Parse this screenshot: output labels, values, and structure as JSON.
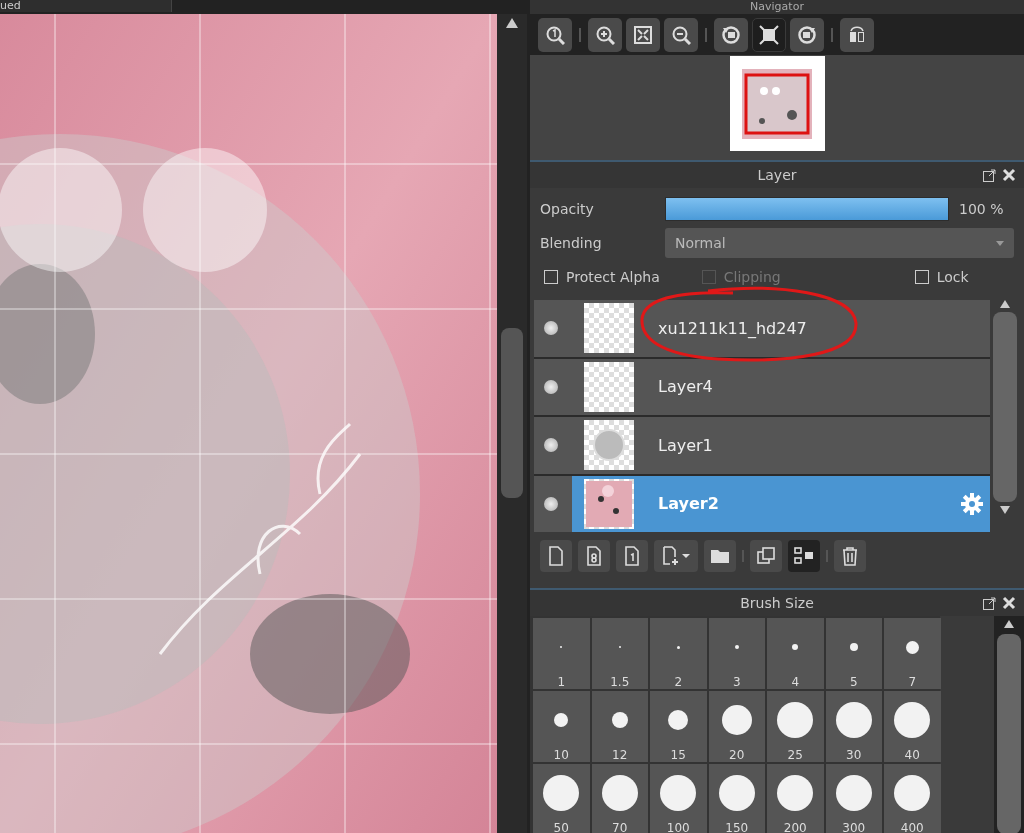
{
  "canvas_tab": {
    "label": "ued"
  },
  "navigator": {
    "title": "Navigator",
    "tools": [
      {
        "selected": false
      },
      {
        "selected": false
      },
      {
        "selected": false
      },
      {
        "selected": false
      },
      {
        "selected": false
      },
      {
        "selected": true
      },
      {
        "selected": false
      },
      {
        "selected": false
      }
    ]
  },
  "layer_panel": {
    "title": "Layer",
    "opacity_label": "Opacity",
    "opacity": {
      "level": 1,
      "reading": "100 %"
    },
    "blending_label": "Blending",
    "blending": "Normal",
    "options": [
      {
        "label": "Protect Alpha",
        "checked": false,
        "disabled": false
      },
      {
        "label": "Clipping",
        "checked": false,
        "disabled": true
      },
      {
        "label": "Lock",
        "checked": false,
        "disabled": false
      }
    ],
    "layers": [
      {
        "name": "xu1211k11_hd247",
        "kind": "empty",
        "selected": false,
        "annotated": true
      },
      {
        "name": "Layer4",
        "kind": "empty",
        "selected": false,
        "annotated": false
      },
      {
        "name": "Layer1",
        "kind": "circle",
        "selected": false,
        "annotated": false
      },
      {
        "name": "Layer2",
        "kind": "art",
        "selected": true,
        "annotated": false
      }
    ]
  },
  "brush_panel": {
    "title": "Brush Size",
    "sizes": [
      "1",
      "1.5",
      "2",
      "3",
      "4",
      "5",
      "7",
      "10",
      "12",
      "15",
      "20",
      "25",
      "30",
      "40",
      "50",
      "70",
      "100",
      "150",
      "200",
      "300",
      "400"
    ]
  }
}
